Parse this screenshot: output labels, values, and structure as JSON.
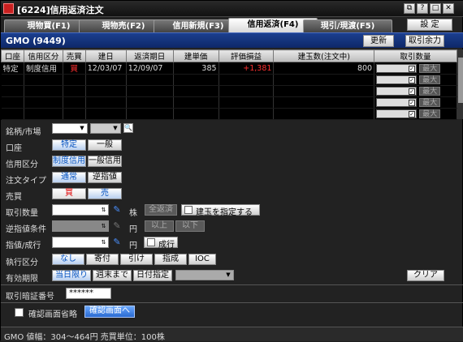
{
  "window": {
    "title": "[6224]信用返済注文",
    "controls": [
      "⧉",
      "?",
      "□",
      "✕"
    ]
  },
  "tabs": [
    {
      "label": "現物買(F1)"
    },
    {
      "label": "現物売(F2)"
    },
    {
      "label": "信用新規(F3)"
    },
    {
      "label": "信用返済(F4)"
    },
    {
      "label": "現引/現渡(F5)"
    }
  ],
  "settings_label": "設 定",
  "stock": {
    "name": "GMO (9449)",
    "refresh_label": "更新",
    "tradable_label": "取引余力"
  },
  "grid": {
    "headers": [
      "口座",
      "信用区分",
      "売買",
      "建日",
      "返済期日",
      "建単価",
      "評価損益",
      "建玉数(注文中)",
      "取引数量"
    ],
    "rows": [
      {
        "account": "特定",
        "type": "制度信用",
        "side": "買",
        "open_date": "12/03/07",
        "due_date": "12/09/07",
        "price": "385",
        "pl": "+1,381",
        "qty": "800",
        "max": "最大"
      }
    ],
    "empty_max_label": "最大",
    "empty_rows": 4
  },
  "form": {
    "brand_label": "銘柄/市場",
    "account_label": "口座",
    "account_options": [
      "特定",
      "一般"
    ],
    "credit_label": "信用区分",
    "credit_options": [
      "制度信用",
      "一般信用"
    ],
    "order_type_label": "注文タイプ",
    "order_type_options": [
      "通常",
      "逆指値"
    ],
    "side_label": "売買",
    "side_buy": "買",
    "side_sell": "売",
    "qty_label": "取引数量",
    "qty_unit": "株",
    "all_return_label": "全返済",
    "specify_label": "建玉を指定する",
    "stop_label": "逆指値条件",
    "yen": "円",
    "above_label": "以上",
    "below_label": "以下",
    "limit_label": "指値/成行",
    "market_label": "成行",
    "exec_label": "執行区分",
    "exec_options": [
      "なし",
      "寄付",
      "引け",
      "指成",
      "IOC"
    ],
    "valid_label": "有効期限",
    "valid_options": [
      "当日限り",
      "週末まで",
      "日付指定"
    ],
    "clear_label": "クリア",
    "pin_label": "取引暗証番号",
    "pin_value": "******",
    "skip_confirm_label": "確認画面省略",
    "confirm_button": "確認画面へ"
  },
  "status": "GMO  値幅：304〜464円  売買単位：100株"
}
